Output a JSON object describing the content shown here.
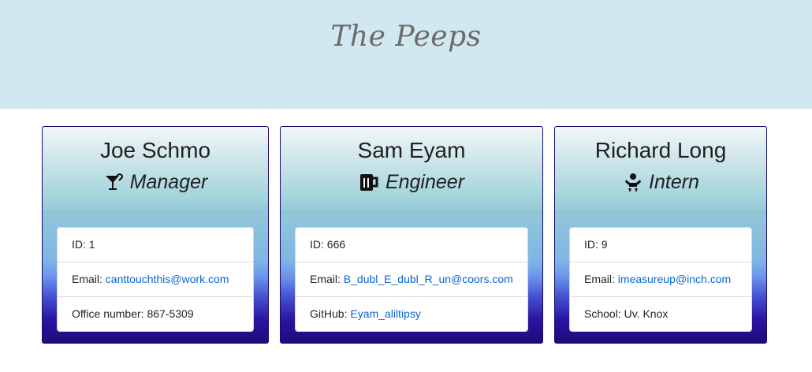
{
  "header": {
    "title": "The Peeps"
  },
  "cards": [
    {
      "name": "Joe Schmo",
      "role": "Manager",
      "role_icon": "mug-saucer-icon",
      "rows": [
        {
          "label": "ID: ",
          "value": "1"
        },
        {
          "label": "Email: ",
          "value": "canttouchthis@work.com"
        },
        {
          "label": "Office number: ",
          "value": "867-5309"
        }
      ]
    },
    {
      "name": "Sam Eyam",
      "role": "Engineer",
      "role_icon": "beer-mug-icon",
      "rows": [
        {
          "label": "ID: ",
          "value": "666"
        },
        {
          "label": "Email: ",
          "value": "B_dubl_E_dubl_R_un@coors.com"
        },
        {
          "label": "GitHub: ",
          "value": "Eyam_aliltipsy"
        }
      ]
    },
    {
      "name": "Richard Long",
      "role": "Intern",
      "role_icon": "baby-icon",
      "rows": [
        {
          "label": "ID: ",
          "value": "9"
        },
        {
          "label": "Email: ",
          "value": "imeasureup@inch.com"
        },
        {
          "label": "School: ",
          "value": "Uv. Knox"
        }
      ]
    }
  ]
}
